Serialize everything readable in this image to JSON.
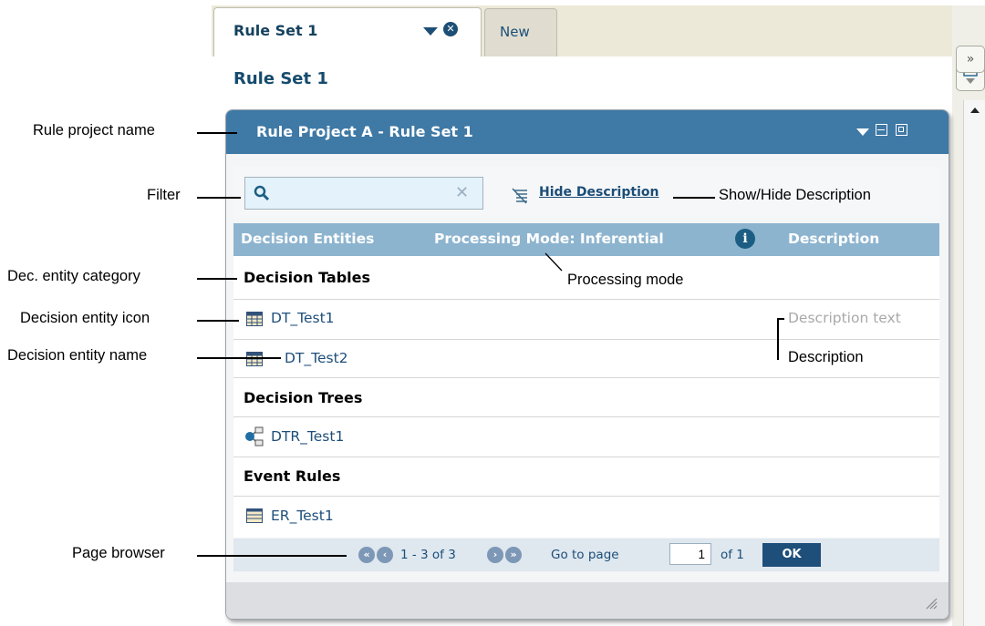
{
  "tabs": [
    {
      "label": "Rule Set 1",
      "active": true
    },
    {
      "label": "New",
      "active": false
    }
  ],
  "heading": "Rule Set 1",
  "right_strip": {
    "collapse_glyph": "»"
  },
  "panel": {
    "title": "Rule Project A - Rule Set 1",
    "filter_placeholder": "",
    "hide_description_label": "Hide Description",
    "columns": [
      "Decision Entities",
      "Processing Mode: Inferential",
      "Description"
    ],
    "categories": [
      {
        "name": "Decision Tables",
        "entities": [
          {
            "name": "DT_Test1",
            "icon": "table-icon",
            "description": "Description text"
          },
          {
            "name": "DT_Test2",
            "icon": "table-icon",
            "description": ""
          }
        ]
      },
      {
        "name": "Decision Trees",
        "entities": [
          {
            "name": "DTR_Test1",
            "icon": "tree-icon",
            "description": ""
          }
        ]
      },
      {
        "name": "Event Rules",
        "entities": [
          {
            "name": "ER_Test1",
            "icon": "event-rule-icon",
            "description": ""
          }
        ]
      }
    ],
    "pager": {
      "range": "1 - 3 of 3",
      "goto_label": "Go to page",
      "page_value": "1",
      "of_label": "of 1",
      "ok_label": "OK"
    }
  },
  "annotations": {
    "rule_project_name": "Rule project name",
    "filter": "Filter",
    "show_hide_description": "Show/Hide Description",
    "dec_entity_category": "Dec. entity category",
    "processing_mode": "Processing mode",
    "decision_entity_icon": "Decision entity icon",
    "decision_entity_name": "Decision entity name",
    "description": "Description",
    "page_browser": "Page browser"
  },
  "colors": {
    "header_blue": "#3f79a5",
    "column_header": "#8db4cf",
    "link": "#1e4e7a"
  }
}
